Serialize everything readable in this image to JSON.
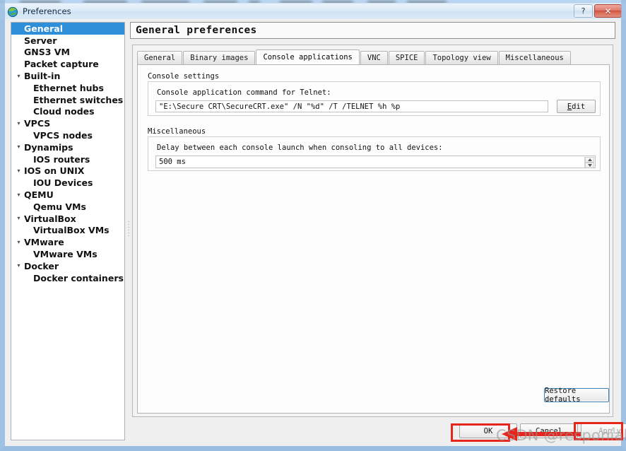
{
  "window": {
    "title": "Preferences",
    "icon": "gns3-globe-icon",
    "help_label": "?",
    "close_label": "✕"
  },
  "sidebar": {
    "items": [
      {
        "label": "General",
        "level": 0,
        "twisty": "",
        "selected": true
      },
      {
        "label": "Server",
        "level": 0,
        "twisty": "",
        "selected": false
      },
      {
        "label": "GNS3 VM",
        "level": 0,
        "twisty": "",
        "selected": false
      },
      {
        "label": "Packet capture",
        "level": 0,
        "twisty": "",
        "selected": false
      },
      {
        "label": "Built-in",
        "level": 0,
        "twisty": "▾",
        "selected": false
      },
      {
        "label": "Ethernet hubs",
        "level": 1,
        "twisty": "",
        "selected": false
      },
      {
        "label": "Ethernet switches",
        "level": 1,
        "twisty": "",
        "selected": false
      },
      {
        "label": "Cloud nodes",
        "level": 1,
        "twisty": "",
        "selected": false
      },
      {
        "label": "VPCS",
        "level": 0,
        "twisty": "▾",
        "selected": false
      },
      {
        "label": "VPCS nodes",
        "level": 1,
        "twisty": "",
        "selected": false
      },
      {
        "label": "Dynamips",
        "level": 0,
        "twisty": "▾",
        "selected": false
      },
      {
        "label": "IOS routers",
        "level": 1,
        "twisty": "",
        "selected": false
      },
      {
        "label": "IOS on UNIX",
        "level": 0,
        "twisty": "▾",
        "selected": false
      },
      {
        "label": "IOU Devices",
        "level": 1,
        "twisty": "",
        "selected": false
      },
      {
        "label": "QEMU",
        "level": 0,
        "twisty": "▾",
        "selected": false
      },
      {
        "label": "Qemu VMs",
        "level": 1,
        "twisty": "",
        "selected": false
      },
      {
        "label": "VirtualBox",
        "level": 0,
        "twisty": "▾",
        "selected": false
      },
      {
        "label": "VirtualBox VMs",
        "level": 1,
        "twisty": "",
        "selected": false
      },
      {
        "label": "VMware",
        "level": 0,
        "twisty": "▾",
        "selected": false
      },
      {
        "label": "VMware VMs",
        "level": 1,
        "twisty": "",
        "selected": false
      },
      {
        "label": "Docker",
        "level": 0,
        "twisty": "▾",
        "selected": false
      },
      {
        "label": "Docker containers",
        "level": 1,
        "twisty": "",
        "selected": false
      }
    ]
  },
  "page": {
    "title": "General preferences",
    "tabs": [
      {
        "label": "General",
        "active": false
      },
      {
        "label": "Binary images",
        "active": false
      },
      {
        "label": "Console applications",
        "active": true
      },
      {
        "label": "VNC",
        "active": false
      },
      {
        "label": "SPICE",
        "active": false
      },
      {
        "label": "Topology view",
        "active": false
      },
      {
        "label": "Miscellaneous",
        "active": false
      }
    ],
    "console_settings": {
      "group_title": "Console settings",
      "telnet_label": "Console application command for Telnet:",
      "telnet_value": "\"E:\\Secure CRT\\SecureCRT.exe\" /N \"%d\" /T /TELNET %h %p",
      "edit_button": "Edit"
    },
    "miscellaneous": {
      "group_title": "Miscellaneous",
      "delay_label": "Delay between each console launch when consoling to all devices:",
      "delay_value": "500 ms"
    },
    "restore_defaults_button": "Restore defaults"
  },
  "dialog_buttons": {
    "ok": "OK",
    "cancel": "Cancel",
    "apply": "Apply"
  },
  "annotations": {
    "watermark": "CSDN @responiabilty",
    "highlight_color": "#e8251c"
  }
}
